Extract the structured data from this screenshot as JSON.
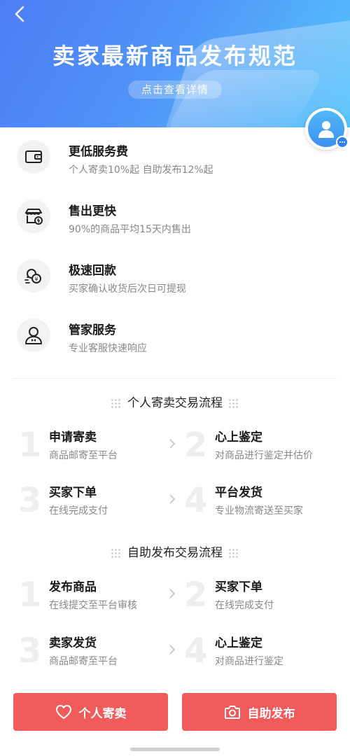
{
  "banner": {
    "title": "卖家最新商品发布规范",
    "link_label": "点击查看详情"
  },
  "features": [
    {
      "title": "更低服务费",
      "desc": "个人寄卖10%起 自助发布12%起",
      "icon": "wallet-icon"
    },
    {
      "title": "售出更快",
      "desc": "90%的商品平均15天内售出",
      "icon": "store-icon"
    },
    {
      "title": "极速回款",
      "desc": "买家确认收货后次日可提现",
      "icon": "coins-icon"
    },
    {
      "title": "管家服务",
      "desc": "专业客服快速响应",
      "icon": "butler-icon"
    }
  ],
  "consign_flow": {
    "title": "个人寄卖交易流程",
    "steps": [
      {
        "num": "1",
        "title": "申请寄卖",
        "desc": "商品邮寄至平台"
      },
      {
        "num": "2",
        "title": "心上鉴定",
        "desc": "对商品进行鉴定并估价"
      },
      {
        "num": "3",
        "title": "买家下单",
        "desc": "在线完成支付"
      },
      {
        "num": "4",
        "title": "平台发货",
        "desc": "专业物流寄送至买家"
      }
    ]
  },
  "self_flow": {
    "title": "自助发布交易流程",
    "steps": [
      {
        "num": "1",
        "title": "发布商品",
        "desc": "在线提交至平台审核"
      },
      {
        "num": "2",
        "title": "买家下单",
        "desc": "在线完成支付"
      },
      {
        "num": "3",
        "title": "卖家发货",
        "desc": "商品邮寄至平台"
      },
      {
        "num": "4",
        "title": "心上鉴定",
        "desc": "对商品进行鉴定"
      }
    ]
  },
  "buttons": {
    "consign_label": "个人寄卖",
    "self_label": "自助发布"
  },
  "colors": {
    "accent": "#f25b5b",
    "banner_start": "#4d7df5",
    "banner_end": "#56c5fb"
  }
}
